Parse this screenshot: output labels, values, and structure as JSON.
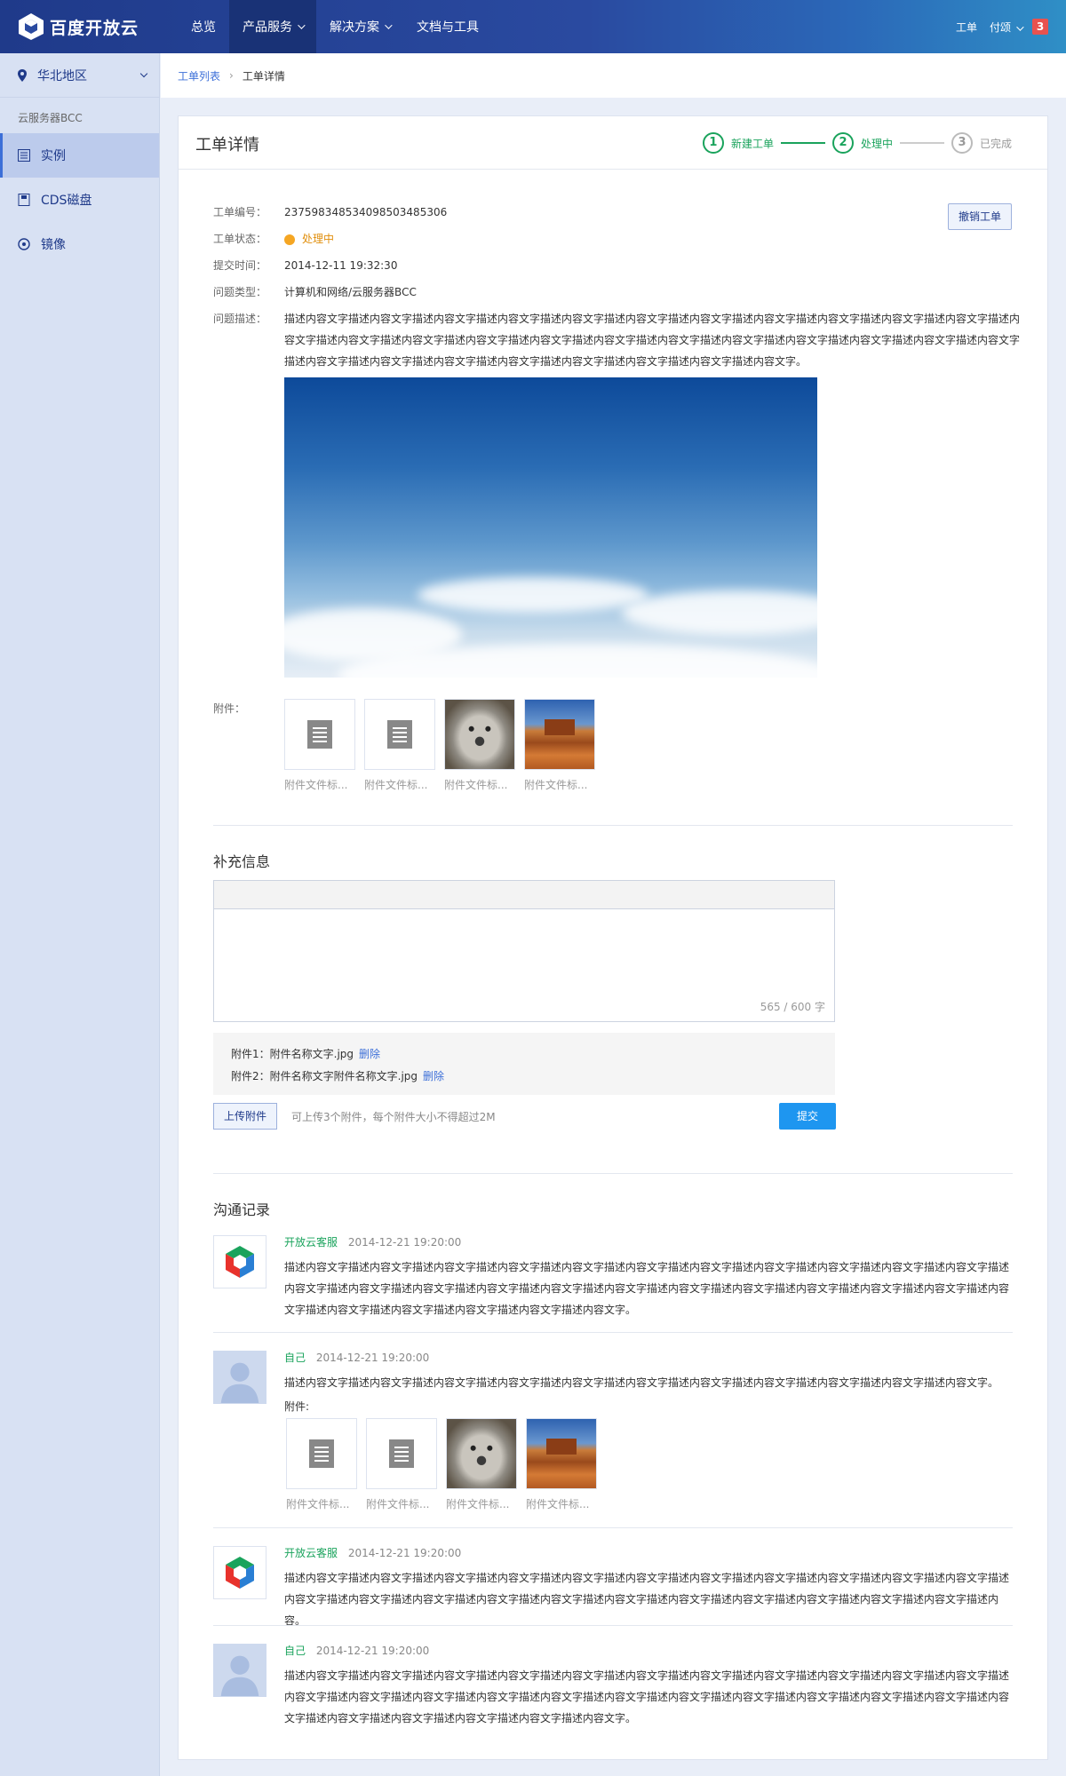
{
  "brand": {
    "name": "百度开放云"
  },
  "topnav": {
    "items": [
      {
        "label": "总览"
      },
      {
        "label": "产品服务"
      },
      {
        "label": "解决方案"
      },
      {
        "label": "文档与工具"
      }
    ],
    "right": {
      "ticket": "工单",
      "user": "付颂",
      "badge": "3"
    }
  },
  "sidebar": {
    "region": "华北地区",
    "group": "云服务器BCC",
    "items": [
      {
        "label": "实例",
        "icon": "instance-icon"
      },
      {
        "label": "CDS磁盘",
        "icon": "disk-icon"
      },
      {
        "label": "镜像",
        "icon": "image-icon"
      }
    ]
  },
  "breadcrumb": {
    "parent": "工单列表",
    "current": "工单详情"
  },
  "page": {
    "title": "工单详情",
    "steps": [
      {
        "num": "1",
        "label": "新建工单"
      },
      {
        "num": "2",
        "label": "处理中"
      },
      {
        "num": "3",
        "label": "已完成"
      }
    ],
    "cancel_label": "撤销工单"
  },
  "ticket": {
    "labels": {
      "id": "工单编号：",
      "status": "工单状态：",
      "time": "提交时间：",
      "type": "问题类型：",
      "desc": "问题描述：",
      "attach": "附件："
    },
    "id": "237598348534098503485306",
    "status": "处理中",
    "time": "2014-12-11  19:32:30",
    "type": "计算机和网络/云服务器BCC",
    "desc": "描述内容文字描述内容文字描述内容文字描述内容文字描述内容文字描述内容文字描述内容文字描述内容文字描述内容文字描述内容文字描述内容文字描述内容文字描述内容文字描述内容文字描述内容文字描述内容文字描述内容文字描述内容文字描述内容文字描述内容文字描述内容文字描述内容文字描述内容文字描述内容文字描述内容文字描述内容文字描述内容文字描述内容文字描述内容文字描述内容文字描述内容文字。",
    "attachments": [
      {
        "caption": "附件文件标...",
        "kind": "doc"
      },
      {
        "caption": "附件文件标...",
        "kind": "doc"
      },
      {
        "caption": "附件文件标...",
        "kind": "koala"
      },
      {
        "caption": "附件文件标...",
        "kind": "desert"
      }
    ]
  },
  "supplement": {
    "title": "补充信息",
    "counter": "565 / 600 字",
    "files": [
      {
        "text": "附件1：附件名称文字.jpg",
        "action": "删除"
      },
      {
        "text": "附件2：附件名称文字附件名称文字.jpg",
        "action": "删除"
      }
    ],
    "upload_label": "上传附件",
    "upload_tip": "可上传3个附件，每个附件大小不得超过2M",
    "submit_label": "提交"
  },
  "records": {
    "title": "沟通记录",
    "attach_label": "附件:",
    "messages": [
      {
        "author": "开放云客服",
        "time": "2014-12-21  19:20:00",
        "text": "描述内容文字描述内容文字描述内容文字描述内容文字描述内容文字描述内容文字描述内容文字描述内容文字描述内容文字描述内容文字描述内容文字描述内容文字描述内容文字描述内容文字描述内容文字描述内容文字描述内容文字描述内容文字描述内容文字描述内容文字描述内容文字描述内容文字描述内容文字描述内容文字描述内容文字描述内容文字描述内容文字描述内容文字。"
      },
      {
        "author": "自己",
        "time": "2014-12-21  19:20:00",
        "text": "描述内容文字描述内容文字描述内容文字描述内容文字描述内容文字描述内容文字描述内容文字描述内容文字描述内容文字描述内容文字描述内容文字。"
      },
      {
        "author": "开放云客服",
        "time": "2014-12-21  19:20:00",
        "text": "描述内容文字描述内容文字描述内容文字描述内容文字描述内容文字描述内容文字描述内容文字描述内容文字描述内容文字描述内容文字描述内容文字描述内容文字描述内容文字描述内容文字描述内容文字描述内容文字描述内容文字描述内容文字描述内容文字描述内容文字描述内容文字描述内容文字描述内容。"
      },
      {
        "author": "自己",
        "time": "2014-12-21  19:20:00",
        "text": "描述内容文字描述内容文字描述内容文字描述内容文字描述内容文字描述内容文字描述内容文字描述内容文字描述内容文字描述内容文字描述内容文字描述内容文字描述内容文字描述内容文字描述内容文字描述内容文字描述内容文字描述内容文字描述内容文字描述内容文字描述内容文字描述内容文字描述内容文字描述内容文字描述内容文字描述内容文字描述内容文字描述内容文字。"
      }
    ],
    "msg2_attachments": [
      {
        "caption": "附件文件标...",
        "kind": "doc"
      },
      {
        "caption": "附件文件标...",
        "kind": "doc"
      },
      {
        "caption": "附件文件标...",
        "kind": "koala"
      },
      {
        "caption": "附件文件标...",
        "kind": "desert"
      }
    ]
  },
  "colors": {
    "nav": "#1f3a8a",
    "green": "#1aa35c",
    "link": "#3c6fd8",
    "submit": "#1e96f0",
    "badge": "#e8524f"
  }
}
